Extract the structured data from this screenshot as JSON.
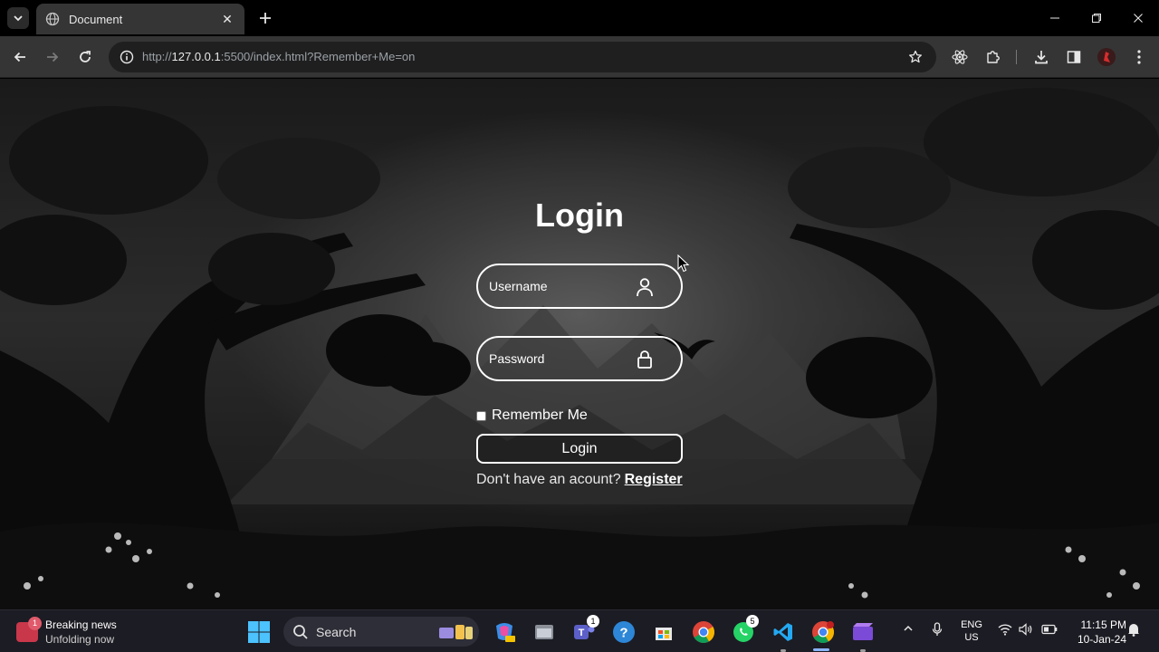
{
  "browser": {
    "tab_title": "Document",
    "url_host": "127.0.0.1",
    "url_prefix": "http://",
    "url_rest": ":5500/index.html?Remember+Me=on"
  },
  "login": {
    "title": "Login",
    "username_placeholder": "Username",
    "password_placeholder": "Password",
    "remember_label": "Remember Me",
    "remember_checked": false,
    "login_button": "Login",
    "register_prompt": "Don't have an acount?",
    "register_link": "Register"
  },
  "taskbar": {
    "news_title": "Breaking news",
    "news_subtitle": "Unfolding now",
    "news_badge": "1",
    "search_label": "Search",
    "teams_badge": "1",
    "whatsapp_badge": "5",
    "lang_line1": "ENG",
    "lang_line2": "US",
    "time": "11:15 PM",
    "date": "10-Jan-24"
  },
  "icons": {
    "tab_search": "chevron-down-icon",
    "back": "arrow-left-icon",
    "forward": "arrow-right-icon",
    "reload": "reload-icon",
    "site_info": "info-icon",
    "bookmark": "star-icon",
    "react_devtools": "atom-icon",
    "extensions": "puzzle-icon",
    "downloads": "download-icon",
    "side_panel": "side-panel-icon",
    "profile": "profile-avatar-icon",
    "menu": "kebab-menu-icon",
    "username_field": "user-icon",
    "password_field": "lock-icon"
  },
  "colors": {
    "browser_frame": "#000000",
    "toolbar": "#353535",
    "omnibox": "#1f1f1f",
    "taskbar": "#1c1c24",
    "form_accent": "#ffffff"
  }
}
